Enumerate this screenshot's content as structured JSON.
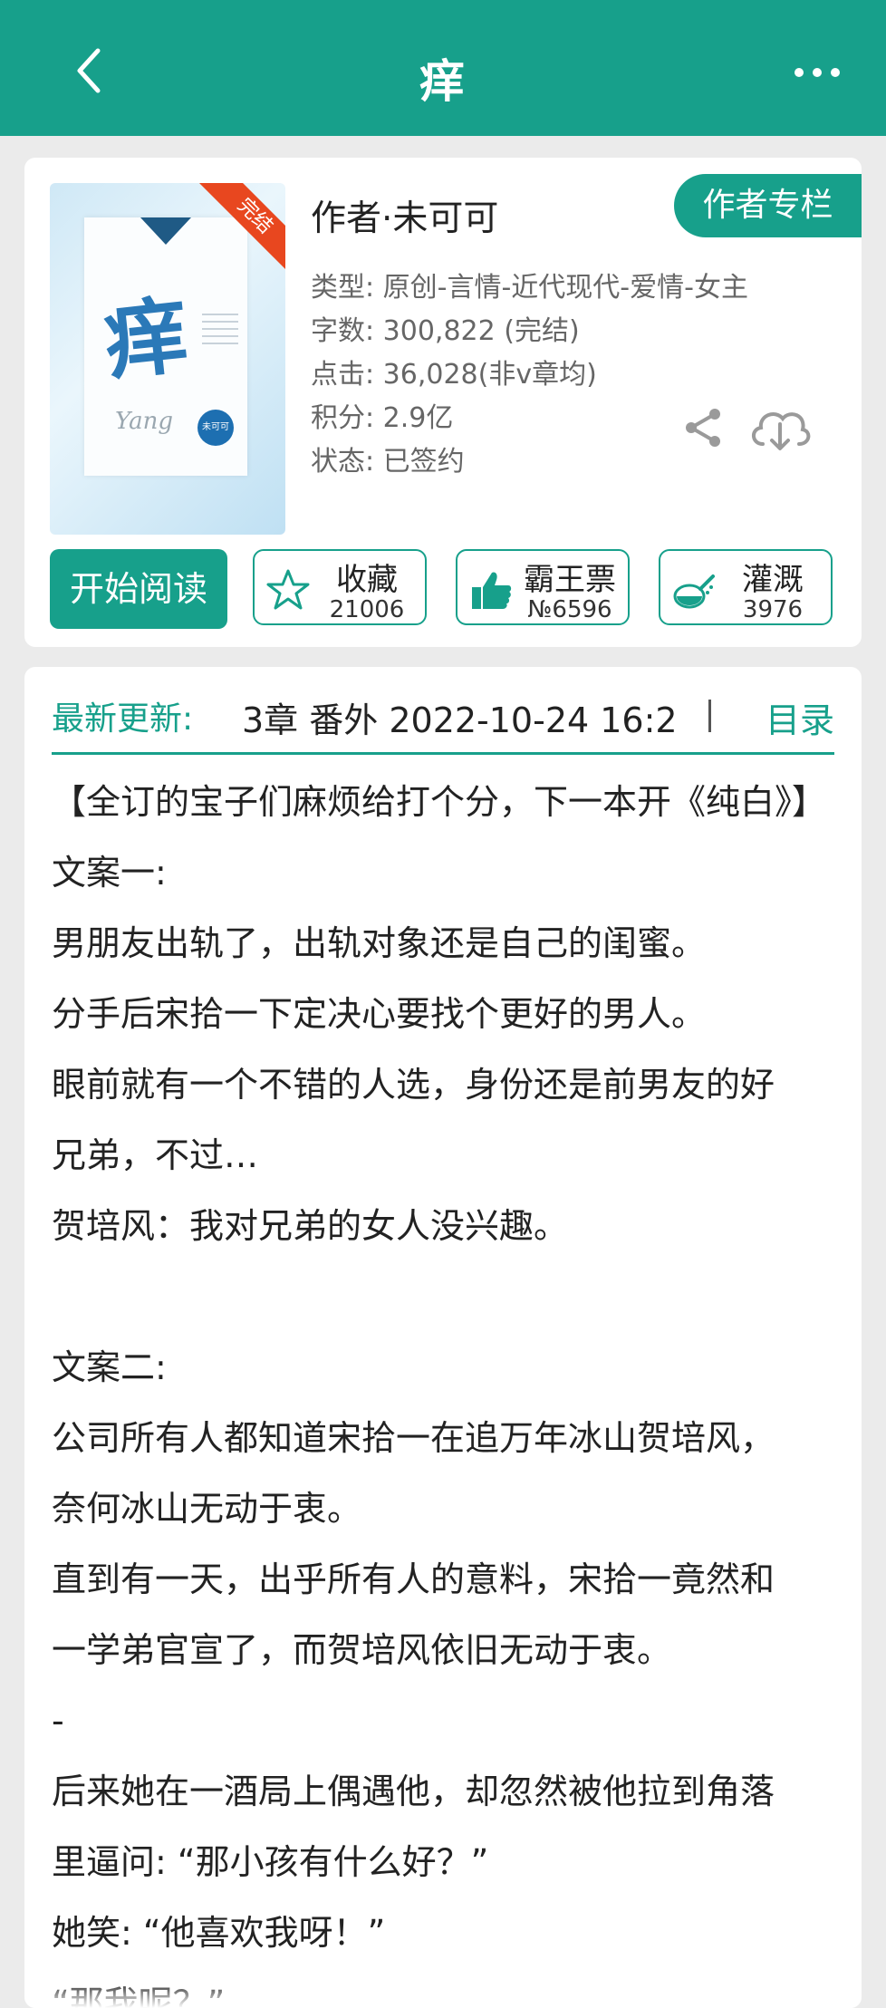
{
  "header": {
    "title": "痒",
    "back_icon": "chevron-left-icon",
    "more_icon": "more-dots-icon"
  },
  "book": {
    "cover": {
      "title_char": "痒",
      "signature": "Yang",
      "seal_text": "未可可",
      "ribbon": "完结"
    },
    "author": "作者·未可可",
    "author_column_button": "作者专栏",
    "type": "类型: 原创-言情-近代现代-爱情-女主",
    "word_count": "字数: 300,822 (完结)",
    "clicks": "点击: 36,028(非v章均)",
    "score": "积分: 2.9亿",
    "status": "状态: 已签约"
  },
  "actions": {
    "start_reading": "开始阅读",
    "favorite": {
      "label": "收藏",
      "count": "21006",
      "icon": "star-icon"
    },
    "bawang": {
      "label": "霸王票",
      "count": "№6596",
      "icon": "thumbs-up-icon"
    },
    "nutrient": {
      "label": "灌溉",
      "count": "3976",
      "icon": "watering-icon"
    }
  },
  "latest": {
    "label": "最新更新:",
    "text": "3章  番外  2022-10-24 16:2",
    "toc": "目录"
  },
  "intro_lines": [
    "【全订的宝子们麻烦给打个分，下一本开《纯白》】",
    "文案一:",
    "男朋友出轨了，出轨对象还是自己的闺蜜。",
    "分手后宋拾一下定决心要找个更好的男人。",
    "眼前就有一个不错的人选，身份还是前男友的好",
    "兄弟，不过…",
    "贺培风：我对兄弟的女人没兴趣。",
    "",
    "文案二:",
    "公司所有人都知道宋拾一在追万年冰山贺培风，",
    "奈何冰山无动于衷。",
    "直到有一天，出乎所有人的意料，宋拾一竟然和",
    "一学弟官宣了，而贺培风依旧无动于衷。",
    "-",
    "后来她在一酒局上偶遇他，却忽然被他拉到角落",
    "里逼问: “那小孩有什么好？”",
    "她笑: “他喜欢我呀！”",
    "“那我呢？”"
  ],
  "colors": {
    "accent": "#17a08b",
    "ribbon": "#e8471f",
    "background": "#ebebeb"
  }
}
